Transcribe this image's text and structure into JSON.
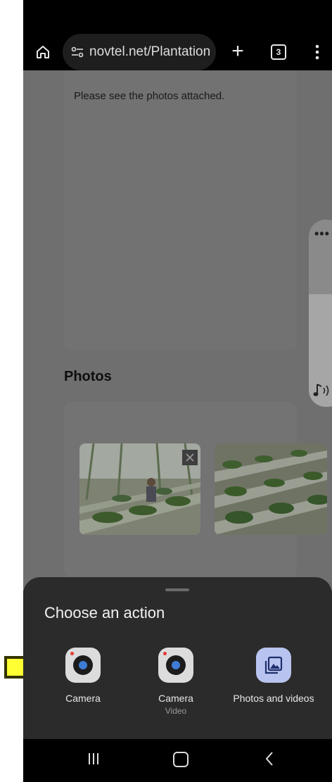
{
  "browser": {
    "url": "novtel.net/Plantation",
    "tab_count": "3"
  },
  "page": {
    "note_text": "Please see the photos attached.",
    "photos_heading": "Photos"
  },
  "sheet": {
    "title": "Choose an action",
    "actions": [
      {
        "label": "Camera",
        "sublabel": "",
        "icon": "camera-icon"
      },
      {
        "label": "Camera",
        "sublabel": "Video",
        "icon": "camera-icon"
      },
      {
        "label": "Photos and videos",
        "sublabel": "",
        "icon": "gallery-icon"
      }
    ]
  },
  "volume": {
    "level_fraction": 0.6
  },
  "colors": {
    "arrow": "#ffff33",
    "arrow_outline": "#333300",
    "gallery_bg": "#b8c4ef",
    "gallery_fg": "#1d2f6b",
    "camera_lens": "#3e7bd6",
    "sheet_bg": "#2b2b2b"
  }
}
